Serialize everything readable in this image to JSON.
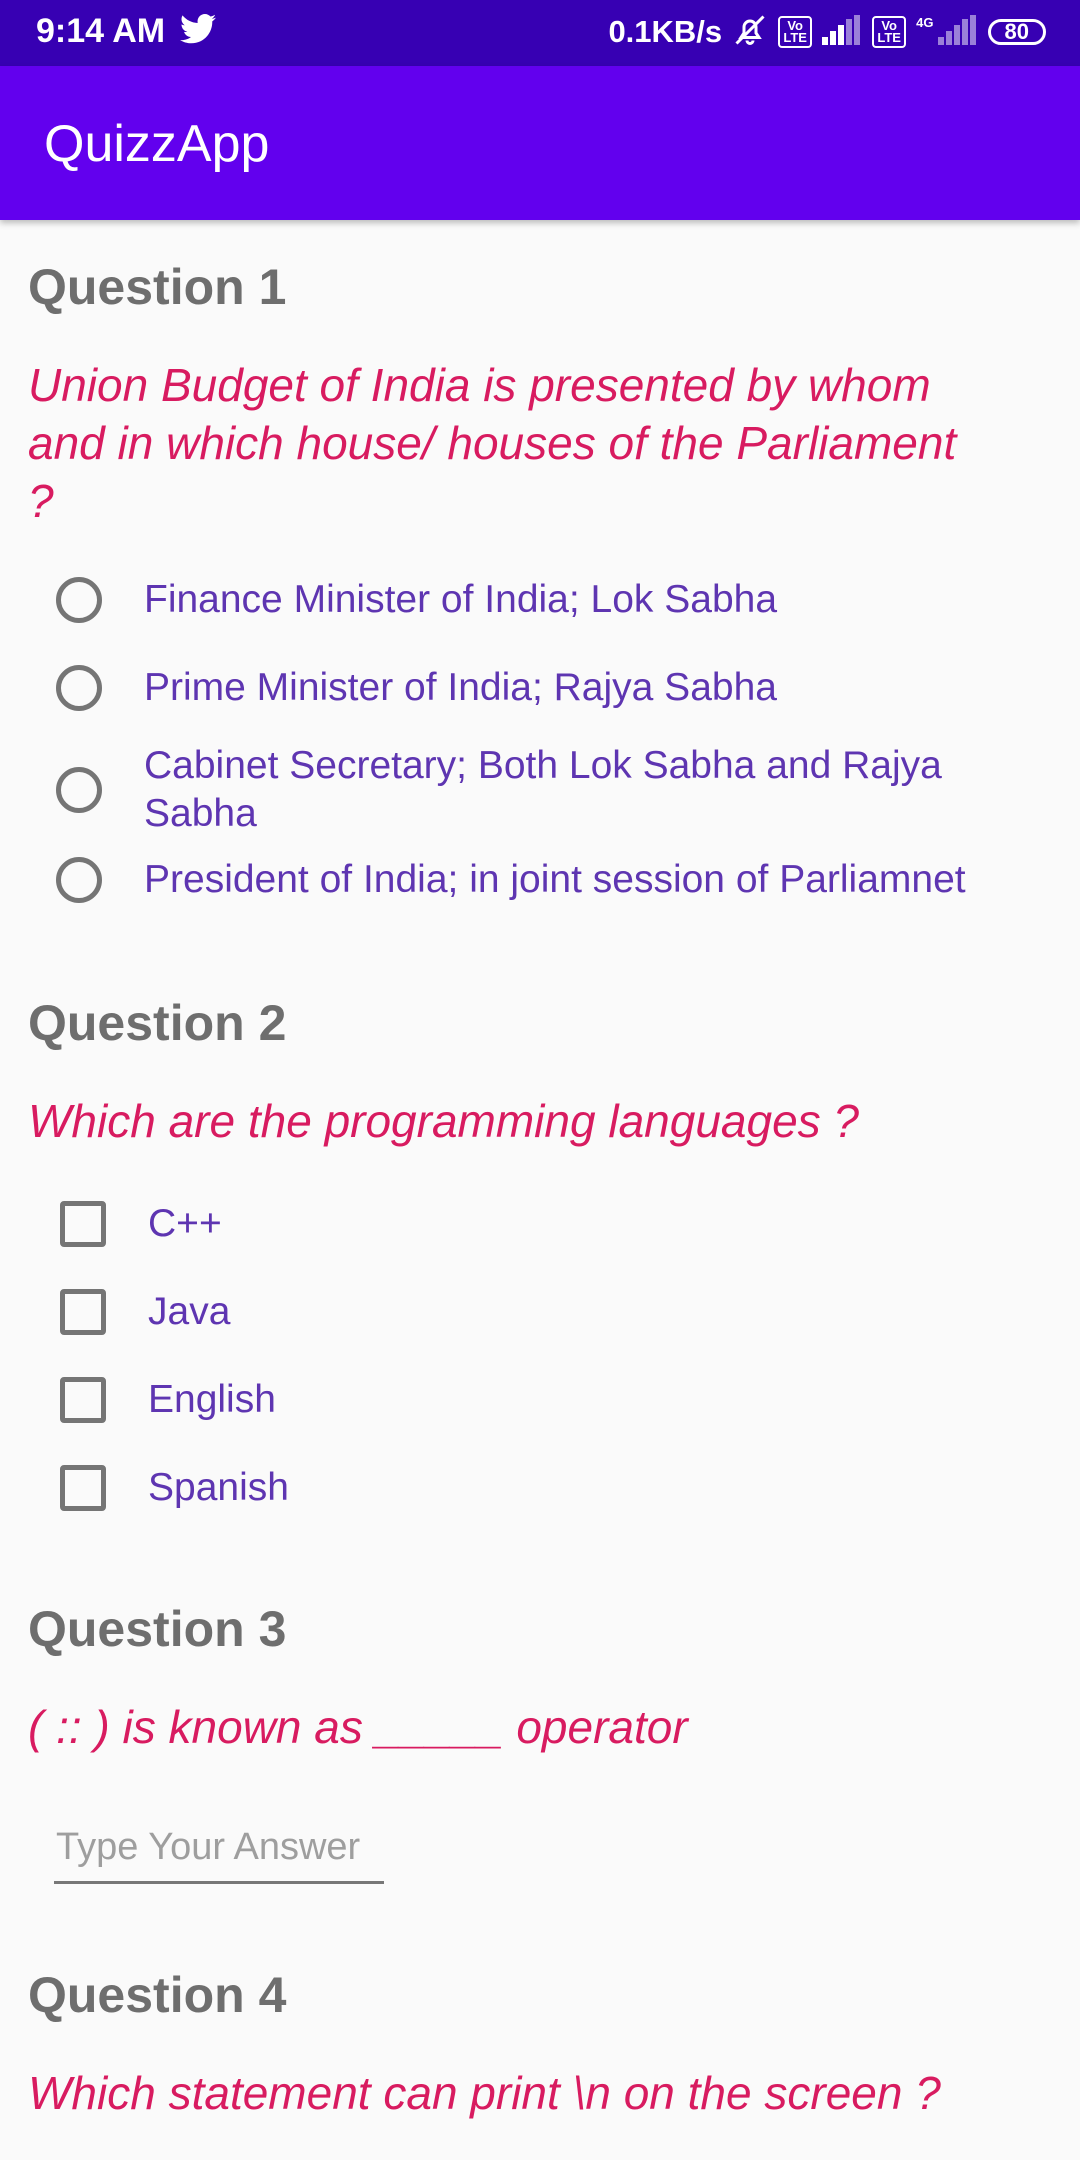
{
  "status_bar": {
    "time": "9:14 AM",
    "network_speed": "0.1KB/s",
    "volte_label_1": "Vo LTE",
    "volte_label_2": "Vo LTE",
    "network_type": "4G",
    "battery": "80"
  },
  "app_bar": {
    "title": "QuizzApp"
  },
  "questions": [
    {
      "heading": "Question 1",
      "text": "Union Budget of India is presented by whom and in which house/ houses of the Parliament ?",
      "type": "radio",
      "options": [
        "Finance Minister of India; Lok Sabha",
        "Prime Minister of India; Rajya Sabha",
        "Cabinet Secretary; Both Lok Sabha and Rajya Sabha",
        "President of India; in joint session of Parliamnet"
      ]
    },
    {
      "heading": "Question 2",
      "text": "Which are the programming languages ?",
      "type": "checkbox",
      "options": [
        "C++",
        "Java",
        "English",
        "Spanish"
      ]
    },
    {
      "heading": "Question 3",
      "text": "( :: ) is known as _____ operator",
      "type": "text",
      "placeholder": "Type Your Answer",
      "value": ""
    },
    {
      "heading": "Question 4",
      "text": "Which statement can print \\n on the screen ?"
    }
  ],
  "colors": {
    "status_bar": "#3700b3",
    "app_bar": "#6200ee",
    "question_text": "#d81b60",
    "option_text": "#5e35b1",
    "heading_text": "#6e6e6e"
  }
}
